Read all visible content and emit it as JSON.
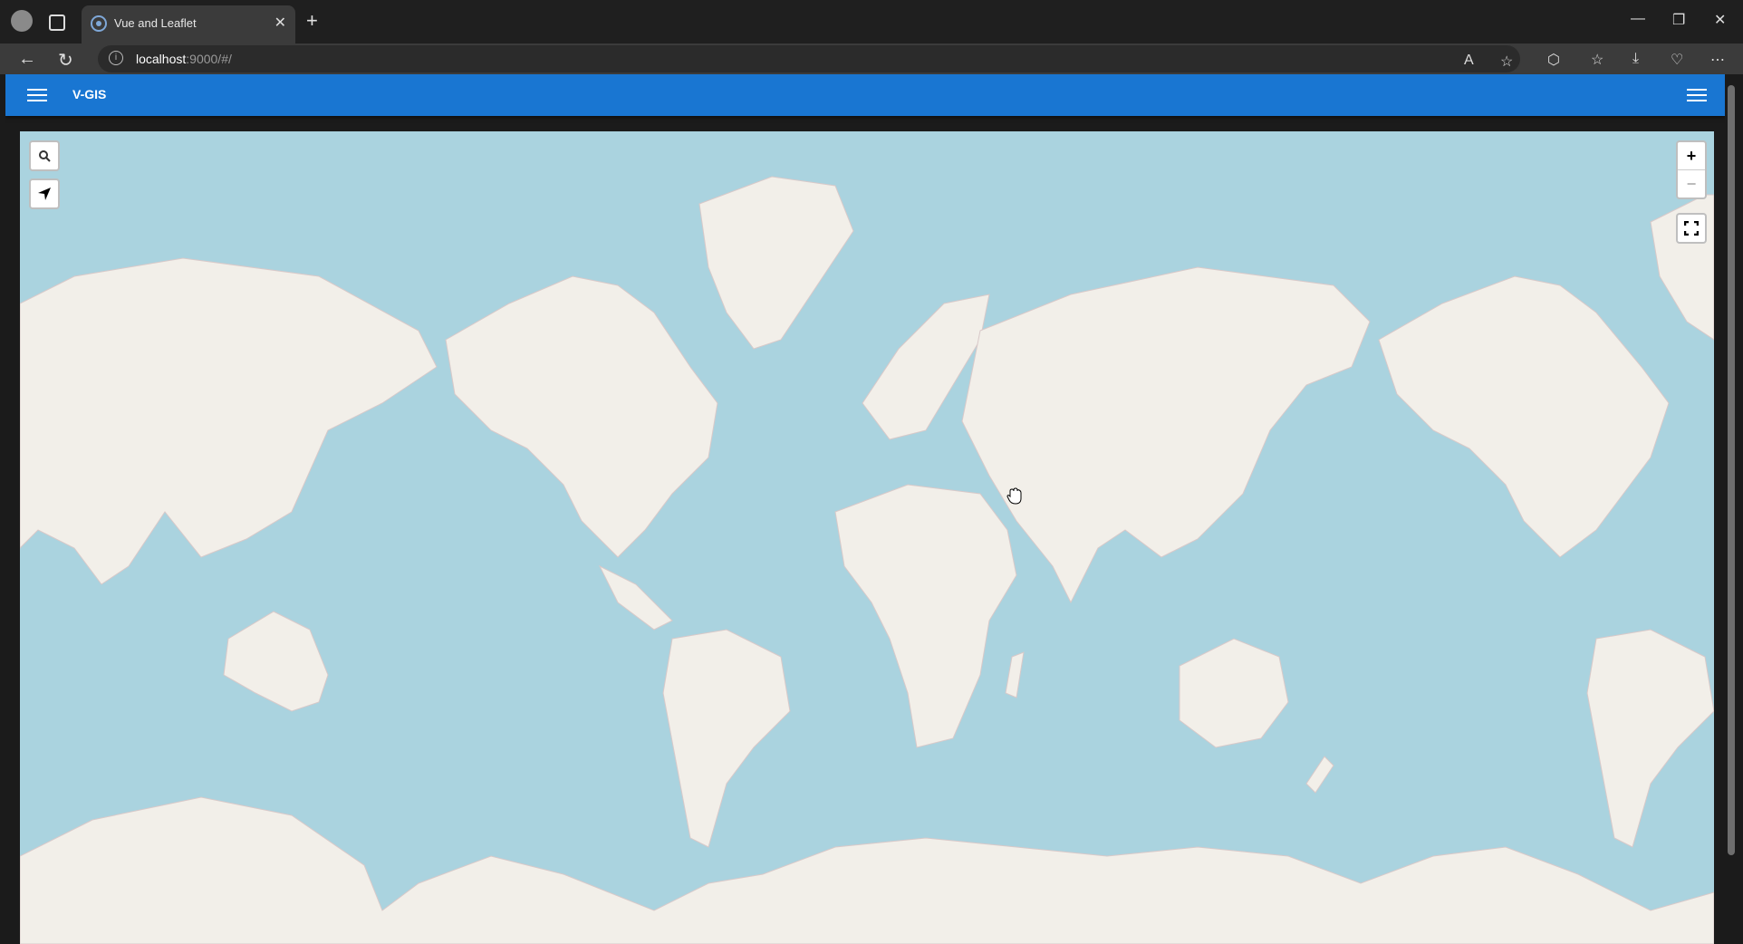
{
  "browser": {
    "tab_title": "Vue and Leaflet",
    "url_host": "localhost",
    "url_rest": ":9000/#/",
    "new_tab_label": "+",
    "close_tab_label": "✕"
  },
  "app": {
    "title": "V-GIS"
  },
  "map": {
    "zoom_in_label": "+",
    "zoom_out_label": "−",
    "search_icon": "search-icon",
    "locate_icon": "navigation-arrow-icon",
    "fullscreen_icon": "fullscreen-icon",
    "colors": {
      "water": "#aad3df",
      "land": "#f2efe9",
      "appbar": "#1976d2"
    }
  }
}
